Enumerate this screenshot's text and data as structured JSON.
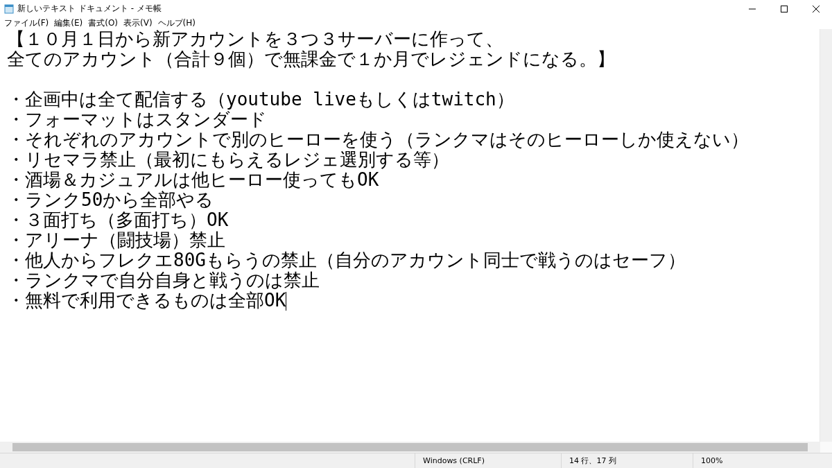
{
  "window": {
    "title": "新しいテキスト ドキュメント - メモ帳"
  },
  "menu": [
    "ファイル(F)",
    "編集(E)",
    "書式(O)",
    "表示(V)",
    "ヘルプ(H)"
  ],
  "editor": {
    "heading": [
      "【１０月１日から新アカウントを３つ３サーバーに作って、",
      "全てのアカウント（合計９個）で無課金で１か月でレジェンドになる。】"
    ],
    "bullets": [
      "・企画中は全て配信する（youtube liveもしくはtwitch）",
      "・フォーマットはスタンダード",
      "・それぞれのアカウントで別のヒーローを使う（ランクマはそのヒーローしか使えない）",
      "・リセマラ禁止（最初にもらえるレジェ選別する等）",
      "・酒場＆カジュアルは他ヒーロー使ってもOK",
      "・ランク50から全部やる",
      "・３面打ち（多面打ち）OK",
      "・アリーナ（闘技場）禁止",
      "・他人からフレクエ80Gもらうの禁止（自分のアカウント同士で戦うのはセーフ）",
      "・ランクマで自分自身と戦うのは禁止",
      "・無料で利用できるものは全部OK"
    ]
  },
  "status_bar": {
    "line_ending": "Windows (CRLF)",
    "position": "14 行、17 列",
    "zoom": "100%"
  }
}
